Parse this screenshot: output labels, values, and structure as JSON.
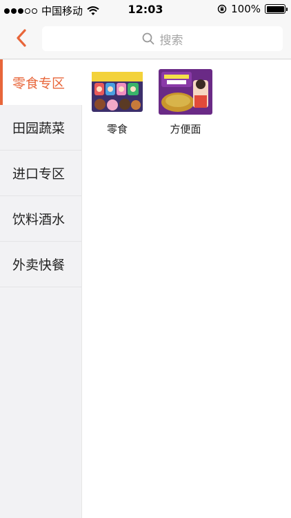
{
  "status_bar": {
    "carrier": "中国移动",
    "time": "12:03",
    "battery": "100%"
  },
  "nav": {
    "search_placeholder": "搜索"
  },
  "sidebar": {
    "items": [
      {
        "label": "零食专区"
      },
      {
        "label": "田园蔬菜"
      },
      {
        "label": "进口专区"
      },
      {
        "label": "饮料酒水"
      },
      {
        "label": "外卖快餐"
      }
    ]
  },
  "products": [
    {
      "label": "零食"
    },
    {
      "label": "方便面"
    }
  ],
  "colors": {
    "accent": "#e8663a",
    "sidebar_bg": "#f2f2f4"
  }
}
